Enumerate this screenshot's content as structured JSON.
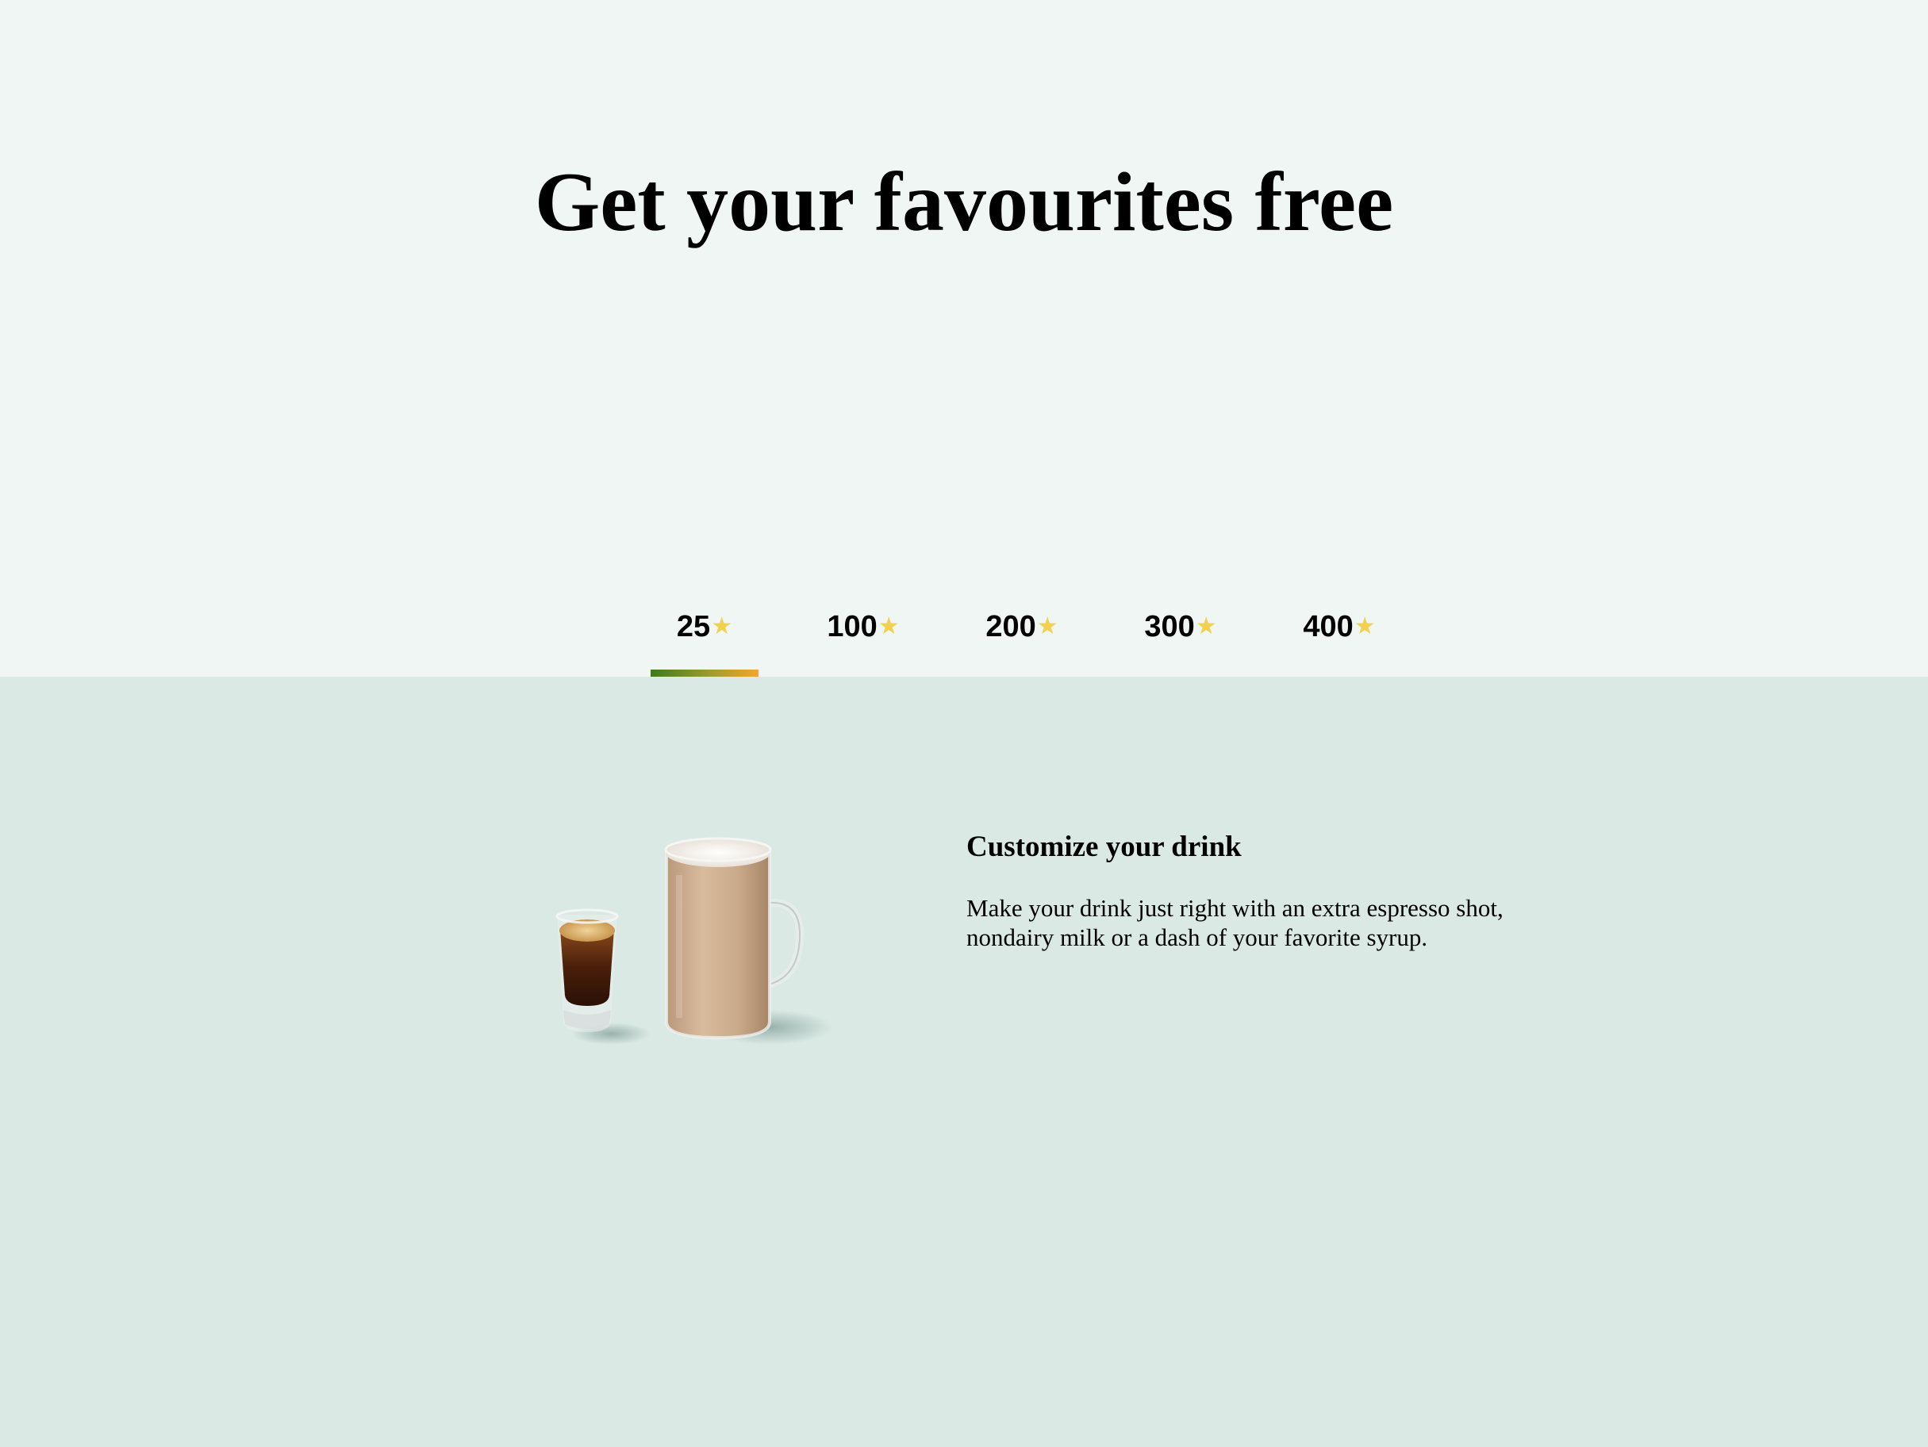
{
  "header": {
    "title": "Get your favourites free"
  },
  "tabs": [
    {
      "value": "25",
      "star": "★",
      "selected": true
    },
    {
      "value": "100",
      "star": "★",
      "selected": false
    },
    {
      "value": "200",
      "star": "★",
      "selected": false
    },
    {
      "value": "300",
      "star": "★",
      "selected": false
    },
    {
      "value": "400",
      "star": "★",
      "selected": false
    }
  ],
  "reward": {
    "image": "espresso-shot-and-latte-mug",
    "title": "Customize your drink",
    "description": "Make your drink just right with an extra espresso shot, nondairy milk or a dash of your favorite syrup."
  },
  "colors": {
    "top_background": "#f0f6f4",
    "content_background": "#dae9e4",
    "star": "#f1d14f",
    "indicator_start": "#3d7a1f",
    "indicator_end": "#f2a72c"
  }
}
